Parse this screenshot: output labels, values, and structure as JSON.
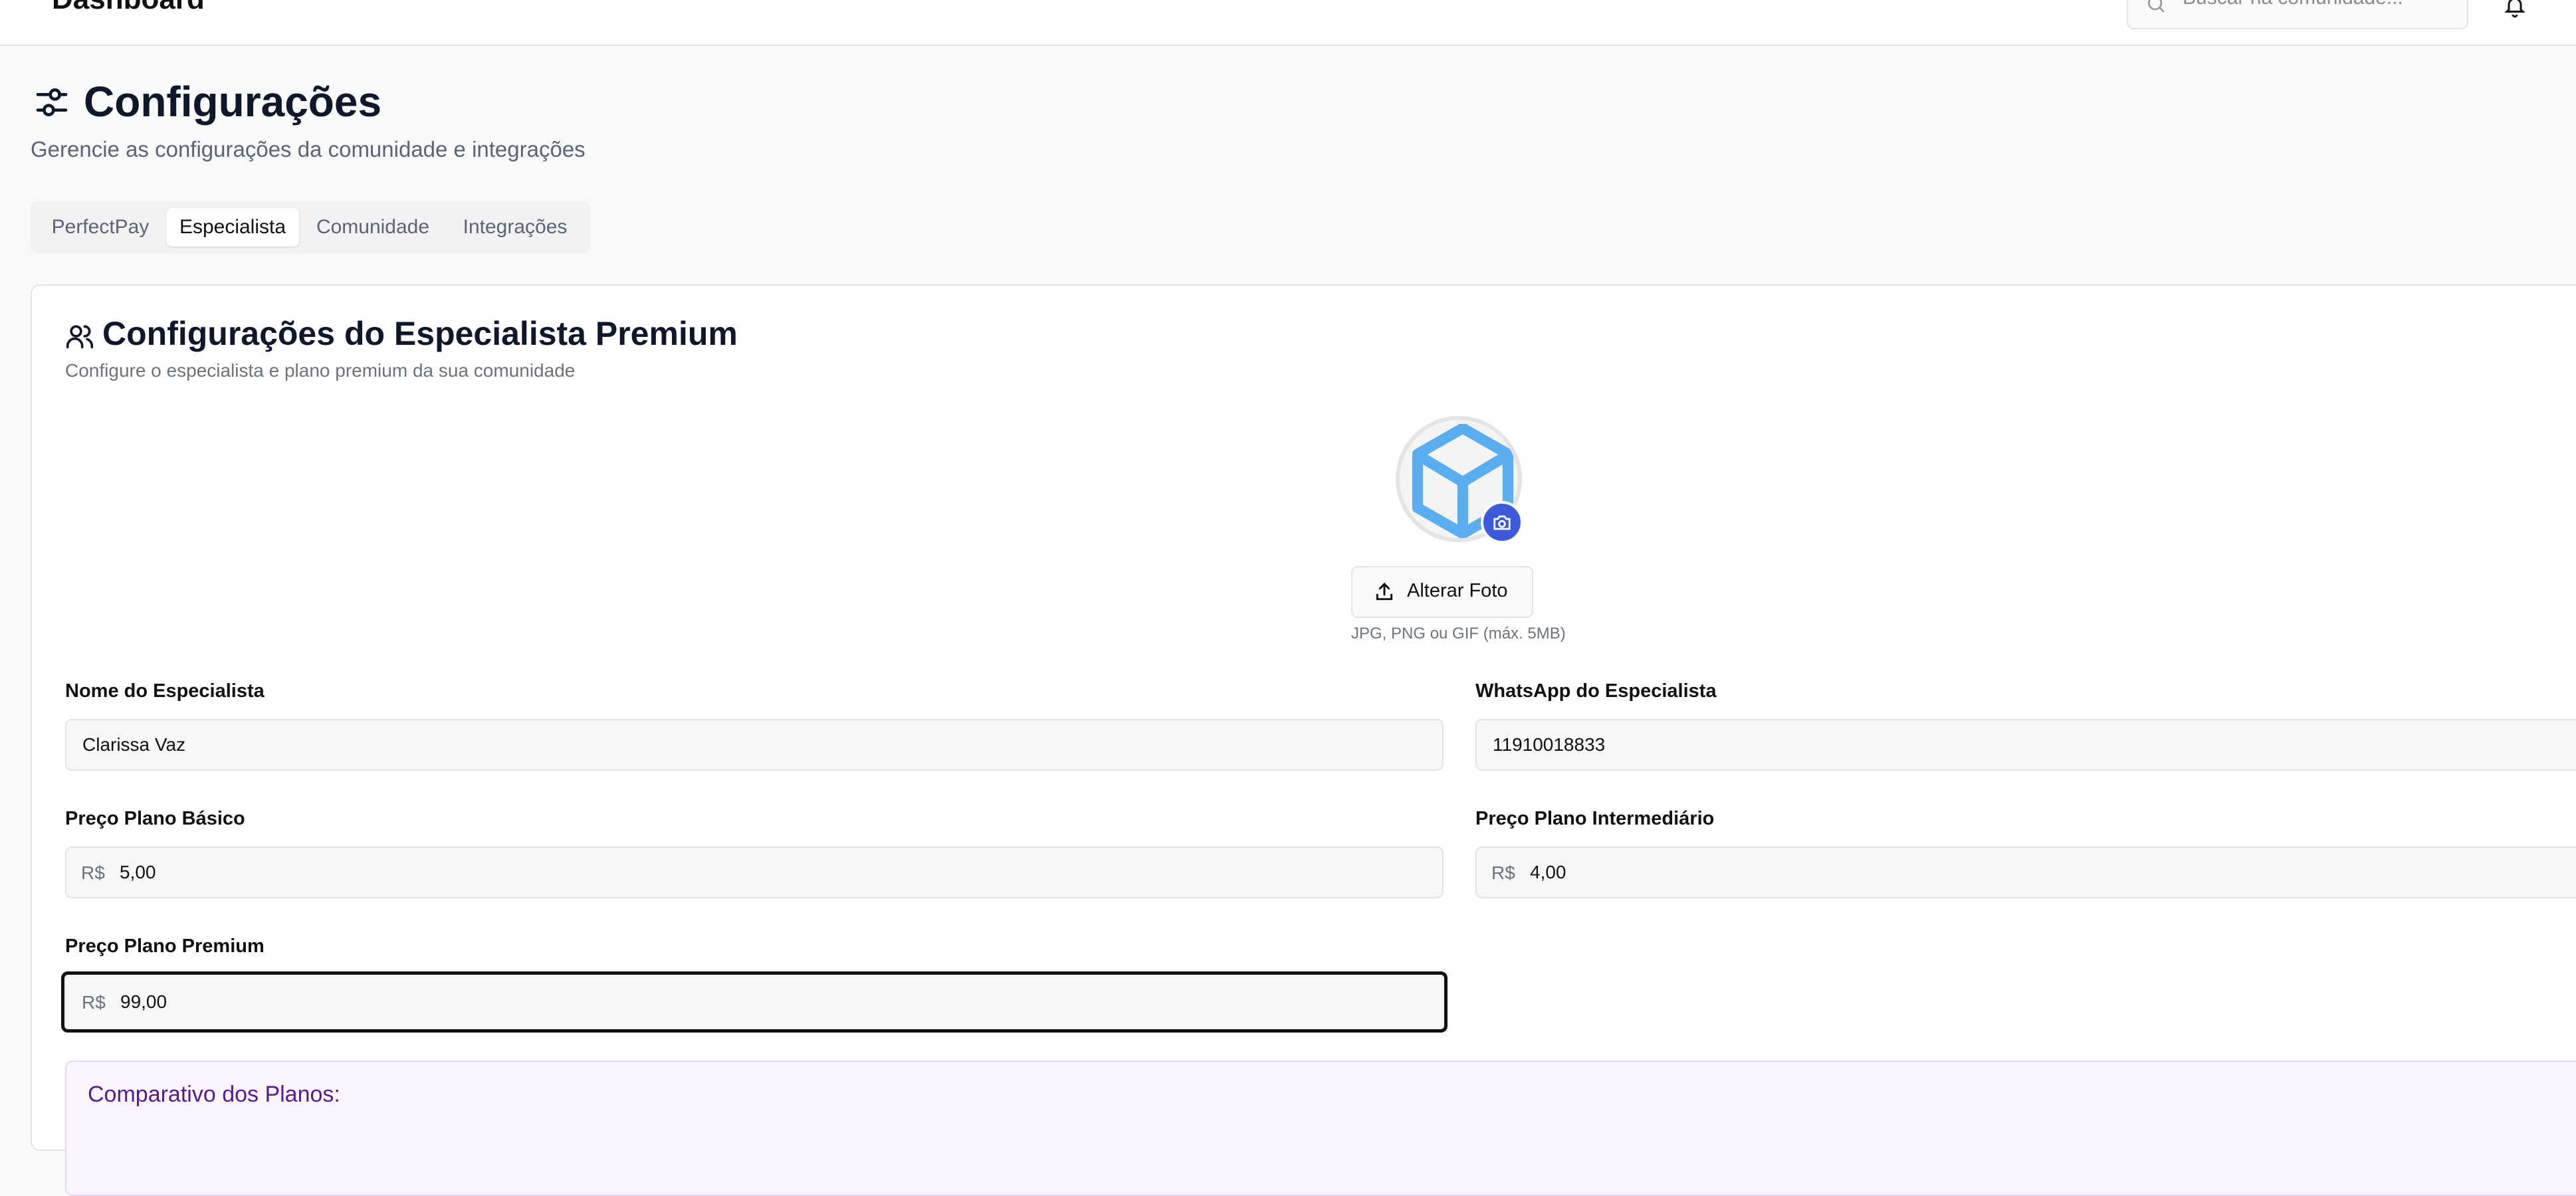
{
  "header": {
    "title": "Dashboard",
    "search_placeholder": "Buscar na comunidade..."
  },
  "page": {
    "title": "Configurações",
    "subtitle": "Gerencie as configurações da comunidade e integrações"
  },
  "tabs": [
    {
      "label": "PerfectPay",
      "active": false
    },
    {
      "label": "Especialista",
      "active": true
    },
    {
      "label": "Comunidade",
      "active": false
    },
    {
      "label": "Integrações",
      "active": false
    }
  ],
  "card": {
    "title": "Configurações do Especialista Premium",
    "subtitle": "Configure o especialista e plano premium da sua comunidade",
    "upload": {
      "button_label": "Alterar Foto",
      "hint": "JPG, PNG ou GIF (máx. 5MB)"
    },
    "fields": {
      "name": {
        "label": "Nome do Especialista",
        "value": "Clarissa Vaz"
      },
      "whatsapp": {
        "label": "WhatsApp do Especialista",
        "value": "11910018833"
      },
      "basic_price": {
        "label": "Preço Plano Básico",
        "prefix": "R$",
        "value": "5,00"
      },
      "intermediate_price": {
        "label": "Preço Plano Intermediário",
        "prefix": "R$",
        "value": "4,00"
      },
      "premium_price": {
        "label": "Preço Plano Premium",
        "prefix": "R$",
        "value": "99,00"
      }
    },
    "comparison_title": "Comparativo dos Planos:"
  },
  "colors": {
    "accent": "#3b5bdb",
    "logo": "#5aaef0",
    "comparison_bg": "#faf5ff",
    "comparison_text": "#581c87"
  }
}
